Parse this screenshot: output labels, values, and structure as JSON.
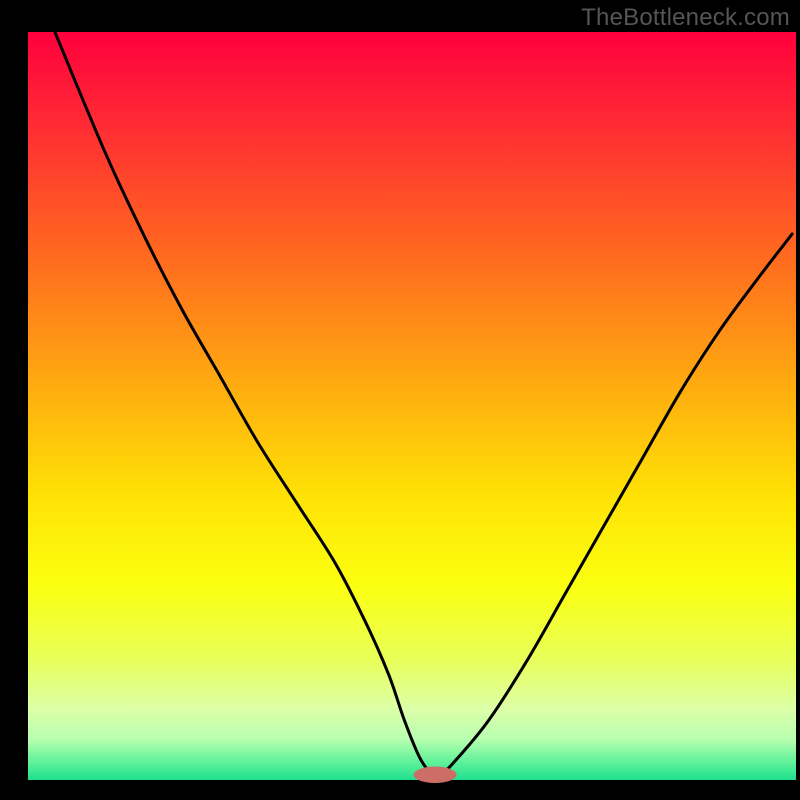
{
  "watermark": "TheBottleneck.com",
  "chart_data": {
    "type": "line",
    "title": "",
    "xlabel": "",
    "ylabel": "",
    "xlim": [
      0,
      100
    ],
    "ylim": [
      0,
      100
    ],
    "background_gradient": {
      "stops": [
        {
          "offset": 0.0,
          "color": "#ff003d"
        },
        {
          "offset": 0.12,
          "color": "#ff2a34"
        },
        {
          "offset": 0.3,
          "color": "#ff6a1f"
        },
        {
          "offset": 0.48,
          "color": "#ffae0f"
        },
        {
          "offset": 0.62,
          "color": "#ffe205"
        },
        {
          "offset": 0.74,
          "color": "#fbff10"
        },
        {
          "offset": 0.84,
          "color": "#e7ff5a"
        },
        {
          "offset": 0.905,
          "color": "#dcffa8"
        },
        {
          "offset": 0.945,
          "color": "#b8ffb0"
        },
        {
          "offset": 0.975,
          "color": "#63f29a"
        },
        {
          "offset": 1.0,
          "color": "#1ee08f"
        }
      ]
    },
    "series": [
      {
        "name": "bottleneck-curve",
        "x": [
          3.5,
          10,
          15,
          20,
          25,
          30,
          35,
          40,
          44,
          47,
          49,
          51,
          52.5,
          54,
          56,
          60,
          65,
          70,
          75,
          80,
          85,
          90,
          95,
          99.5
        ],
        "values": [
          100,
          84,
          73,
          63,
          54,
          45,
          37,
          29,
          21,
          14,
          8,
          3,
          1,
          1,
          3,
          8,
          16,
          25,
          34,
          43,
          52,
          60,
          67,
          73
        ]
      }
    ],
    "marker": {
      "name": "optimal-point",
      "x": 53,
      "y": 0.7,
      "rx": 2.8,
      "ry": 1.1,
      "color": "#cc6d66"
    },
    "plot_inset": {
      "left": 3.5,
      "right": 0.5,
      "top": 4.0,
      "bottom": 2.5
    }
  }
}
